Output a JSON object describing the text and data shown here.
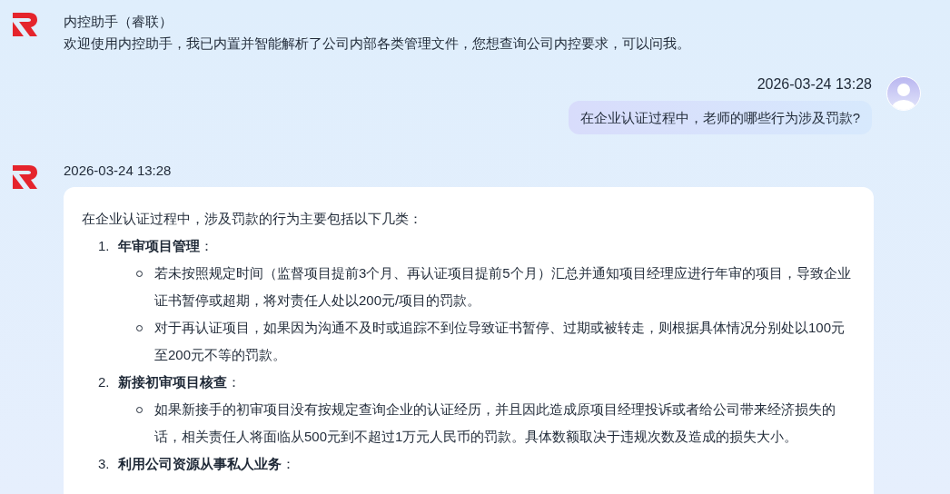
{
  "messages": [
    {
      "kind": "bot",
      "sender": "内控助手（睿联）",
      "text": "欢迎使用内控助手，我已内置并智能解析了公司内部各类管理文件，您想查询公司内控要求，可以问我。"
    },
    {
      "kind": "user",
      "time": "2026-03-24 13:28",
      "text": "在企业认证过程中，老师的哪些行为涉及罚款?"
    },
    {
      "kind": "answer",
      "time": "2026-03-24 13:28",
      "intro": "在企业认证过程中，涉及罚款的行为主要包括以下几类：",
      "sections": [
        {
          "number": "1.",
          "title": "**年审项目管理**：",
          "points": [
            "若未按照规定时间（监督项目提前3个月、再认证项目提前5个月）汇总并通知项目经理应进行年审的项目，导致企业证书暂停或超期，将对责任人处以200元/项目的罚款。",
            "对于再认证项目，如果因为沟通不及时或追踪不到位导致证书暂停、过期或被转走，则根据具体情况分别处以100元至200元不等的罚款。"
          ]
        },
        {
          "number": "2.",
          "title": "**新接初审项目核查**：",
          "points": [
            "如果新接手的初审项目没有按规定查询企业的认证经历，并且因此造成原项目经理投诉或者给公司带来经济损失的话，相关责任人将面临从500元到不超过1万元人民币的罚款。具体数额取决于违规次数及造成的损失大小。"
          ]
        },
        {
          "number": "3.",
          "title": "**利用公司资源从事私人业务**："
        }
      ]
    }
  ]
}
